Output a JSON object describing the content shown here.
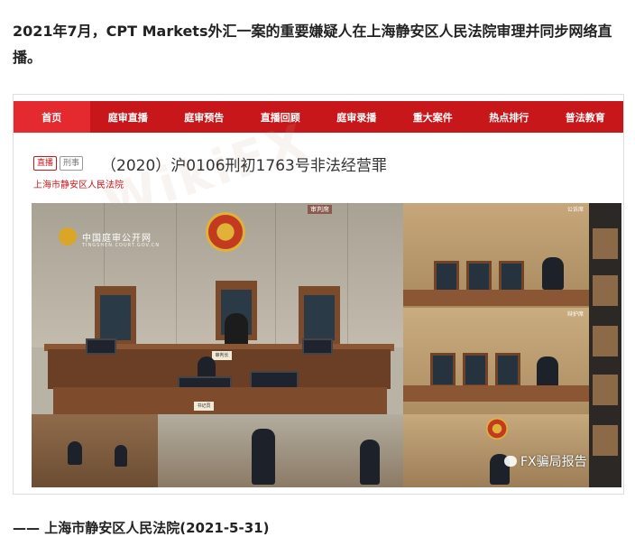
{
  "headline": "2021年7月，CPT Markets外汇一案的重要嫌疑人在上海静安区人民法院审理并同步网络直播。",
  "nav": {
    "items": [
      "首页",
      "庭审直播",
      "庭审预告",
      "直播回顾",
      "庭审录播",
      "重大案件",
      "热点排行",
      "普法教育"
    ],
    "active_index": 0
  },
  "case": {
    "tag_live": "直播",
    "tag_type": "刑事",
    "title": "（2020）沪0106刑初1763号非法经营罪",
    "court": "上海市静安区人民法院"
  },
  "video": {
    "logo_text": "中国庭审公开网",
    "logo_sub": "TINGSHEN.COURT.GOV.CN",
    "caption_top": "审判席",
    "placard_judge": "审判长",
    "placard_clerk": "书记员",
    "right_tag_1": "公诉席",
    "right_tag_2": "辩护席",
    "overlay_label": "FX骗局报告"
  },
  "watermark": "WikiFX",
  "footer": "—— 上海市静安区人民法院(2021-5-31)",
  "colors": {
    "nav_bg": "#c8171b",
    "nav_active": "#e52a2f",
    "accent": "#c8171b"
  }
}
